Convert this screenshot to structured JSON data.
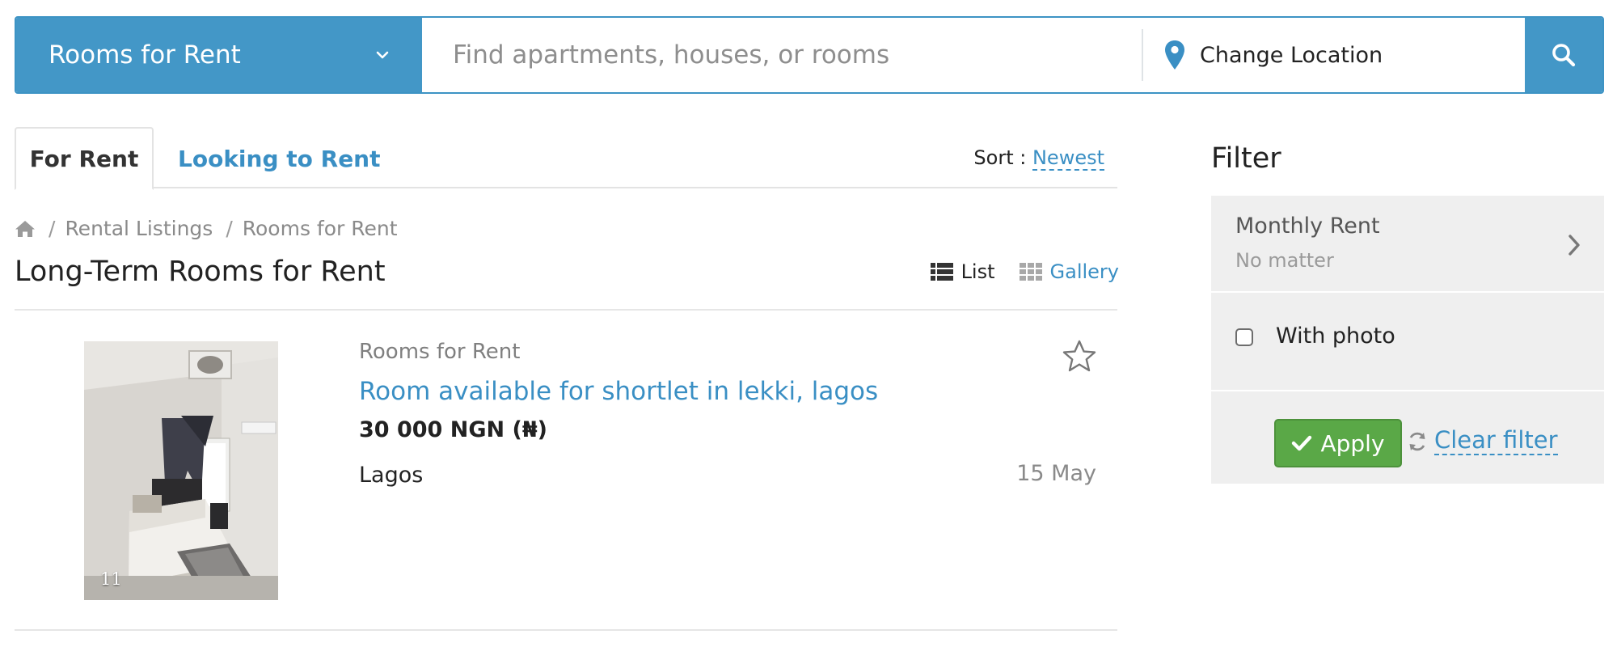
{
  "search": {
    "category": "Rooms for Rent",
    "placeholder": "Find apartments, houses, or rooms",
    "value": "",
    "location": "Change Location"
  },
  "tabs": [
    {
      "label": "For Rent",
      "active": true
    },
    {
      "label": "Looking to Rent",
      "active": false
    }
  ],
  "sort": {
    "label": "Sort :",
    "value": "Newest"
  },
  "breadcrumb": [
    "Rental Listings",
    "Rooms for Rent"
  ],
  "page_title": "Long-Term Rooms for Rent",
  "view": {
    "list": "List",
    "gallery": "Gallery",
    "selected": "List"
  },
  "listings": [
    {
      "category": "Rooms for Rent",
      "title": "Room available for shortlet in lekki, lagos",
      "price": "30 000 NGN (₦)",
      "city": "Lagos",
      "date": "15 May",
      "photo_count": "11"
    }
  ],
  "filter": {
    "title": "Filter",
    "monthly_rent_label": "Monthly Rent",
    "monthly_rent_value": "No matter",
    "with_photo_label": "With photo",
    "with_photo_checked": false,
    "apply_label": "Apply",
    "clear_label": "Clear filter"
  },
  "colors": {
    "brand_blue": "#4397c7",
    "link_blue": "#3a8fc4",
    "apply_green": "#5aa847",
    "filter_bg": "#efefef"
  },
  "icons": {
    "category_dropdown": "chevron-down-icon",
    "location": "map-pin-icon",
    "search": "search-icon",
    "home": "home-icon",
    "list_view": "list-icon",
    "gallery_view": "grid-icon",
    "favorite": "star-icon",
    "filter_expand": "chevron-right-icon",
    "apply": "check-icon",
    "clear": "refresh-icon"
  }
}
